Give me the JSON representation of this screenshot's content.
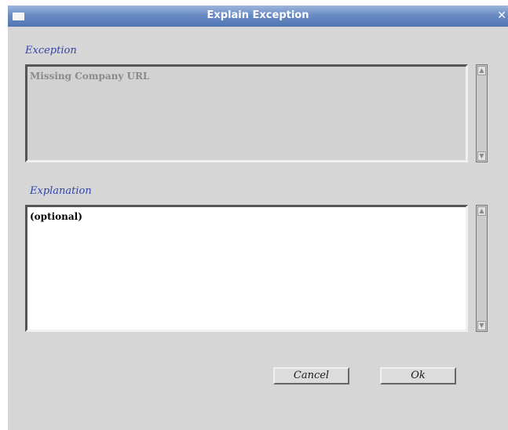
{
  "window": {
    "title": "Explain Exception",
    "close_glyph": "✕"
  },
  "exception": {
    "label": "Exception",
    "text": "Missing Company URL"
  },
  "explanation": {
    "label": "Explanation",
    "text": "(optional)"
  },
  "scroll": {
    "up_glyph": "▲",
    "down_glyph": "▼"
  },
  "buttons": {
    "cancel": "Cancel",
    "ok": "Ok"
  },
  "colors": {
    "title_bar": "#6a8cc4",
    "label_text": "#3144a8",
    "dialog_bg": "#d6d6d6"
  }
}
